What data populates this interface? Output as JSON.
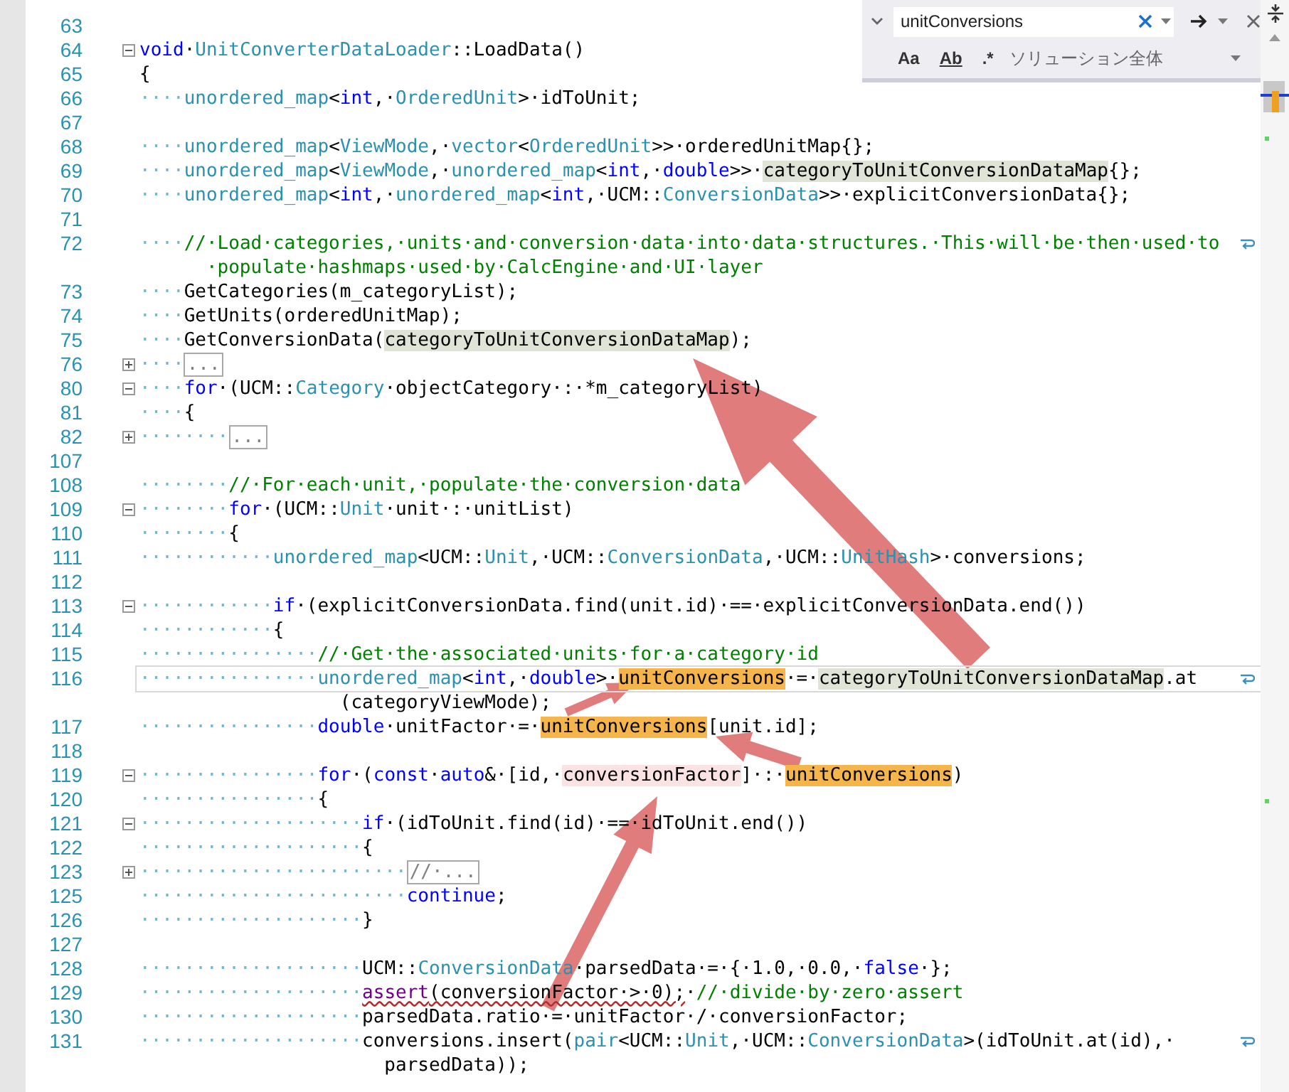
{
  "find_panel": {
    "search_value": "unitConversions",
    "options": [
      {
        "text": "Aa",
        "selected": false
      },
      {
        "text": "Ab",
        "selected": false
      },
      {
        "text": ".*",
        "selected": false
      }
    ],
    "scope": "ソリューション全体"
  },
  "lines": [
    {
      "number": "63"
    },
    {
      "number": "64",
      "fold": {
        "kind": "minus"
      },
      "segments": [
        {
          "kind": "keyword",
          "text": "void"
        },
        {
          "kind": "plain",
          "text": "·"
        },
        {
          "kind": "type",
          "text": "UnitConverterDataLoader"
        },
        {
          "kind": "plain",
          "text": "::LoadData()"
        }
      ]
    },
    {
      "number": "65",
      "segments": [
        {
          "kind": "plain",
          "text": "{"
        }
      ]
    },
    {
      "number": "66",
      "segments": [
        {
          "kind": "indent",
          "text": "····"
        },
        {
          "kind": "type",
          "text": "unordered_map"
        },
        {
          "kind": "plain",
          "text": "<"
        },
        {
          "kind": "keyword",
          "text": "int"
        },
        {
          "kind": "plain",
          "text": ",·"
        },
        {
          "kind": "type",
          "text": "OrderedUnit"
        },
        {
          "kind": "plain",
          "text": ">·idToUnit;"
        }
      ]
    },
    {
      "number": "67"
    },
    {
      "number": "68",
      "segments": [
        {
          "kind": "indent",
          "text": "····"
        },
        {
          "kind": "type",
          "text": "unordered_map"
        },
        {
          "kind": "plain",
          "text": "<"
        },
        {
          "kind": "type",
          "text": "ViewMode"
        },
        {
          "kind": "plain",
          "text": ",·"
        },
        {
          "kind": "type",
          "text": "vector"
        },
        {
          "kind": "plain",
          "text": "<"
        },
        {
          "kind": "type",
          "text": "OrderedUnit"
        },
        {
          "kind": "plain",
          "text": ">>·orderedUnitMap{};"
        }
      ]
    },
    {
      "number": "69",
      "segments": [
        {
          "kind": "indent",
          "text": "····"
        },
        {
          "kind": "type",
          "text": "unordered_map"
        },
        {
          "kind": "plain",
          "text": "<"
        },
        {
          "kind": "type",
          "text": "ViewMode"
        },
        {
          "kind": "plain",
          "text": ",·"
        },
        {
          "kind": "type",
          "text": "unordered_map"
        },
        {
          "kind": "plain",
          "text": "<"
        },
        {
          "kind": "keyword",
          "text": "int"
        },
        {
          "kind": "plain",
          "text": ",·"
        },
        {
          "kind": "keyword",
          "text": "double"
        },
        {
          "kind": "plain",
          "text": ">>·"
        },
        {
          "kind": "plain",
          "text": "categoryToUnitConversionDataMap",
          "highlight": {
            "kind": "reference"
          }
        },
        {
          "kind": "plain",
          "text": "{};"
        }
      ]
    },
    {
      "number": "70",
      "segments": [
        {
          "kind": "indent",
          "text": "····"
        },
        {
          "kind": "type",
          "text": "unordered_map"
        },
        {
          "kind": "plain",
          "text": "<"
        },
        {
          "kind": "keyword",
          "text": "int"
        },
        {
          "kind": "plain",
          "text": ",·"
        },
        {
          "kind": "type",
          "text": "unordered_map"
        },
        {
          "kind": "plain",
          "text": "<"
        },
        {
          "kind": "keyword",
          "text": "int"
        },
        {
          "kind": "plain",
          "text": ",·UCM::"
        },
        {
          "kind": "type",
          "text": "ConversionData"
        },
        {
          "kind": "plain",
          "text": ">>·explicitConversionData{};"
        }
      ]
    },
    {
      "number": "71"
    },
    {
      "number": "72",
      "wrapped": true,
      "segments": [
        {
          "kind": "indent",
          "text": "····"
        },
        {
          "kind": "comment",
          "text": "//·Load·categories,·units·and·conversion·data·into·data·structures.·This·will·be·then·used·to"
        }
      ],
      "continuation": [
        {
          "kind": "comment",
          "text": "·populate·hashmaps·used·by·CalcEngine·and·UI·layer"
        }
      ]
    },
    {
      "number": "73",
      "segments": [
        {
          "kind": "indent",
          "text": "····"
        },
        {
          "kind": "plain",
          "text": "GetCategories(m_categoryList);"
        }
      ]
    },
    {
      "number": "74",
      "segments": [
        {
          "kind": "indent",
          "text": "····"
        },
        {
          "kind": "plain",
          "text": "GetUnits(orderedUnitMap);"
        }
      ]
    },
    {
      "number": "75",
      "segments": [
        {
          "kind": "indent",
          "text": "····"
        },
        {
          "kind": "plain",
          "text": "GetConversionData("
        },
        {
          "kind": "plain",
          "text": "categoryToUnitConversionDataMap",
          "highlight": {
            "kind": "reference"
          }
        },
        {
          "kind": "plain",
          "text": ");"
        }
      ]
    },
    {
      "number": "76",
      "fold": {
        "kind": "plus"
      },
      "segments": [
        {
          "kind": "indent",
          "text": "····"
        },
        {
          "kind": "collapsed",
          "text": "..."
        }
      ]
    },
    {
      "number": "80",
      "fold": {
        "kind": "minus"
      },
      "segments": [
        {
          "kind": "indent",
          "text": "····"
        },
        {
          "kind": "keyword",
          "text": "for"
        },
        {
          "kind": "plain",
          "text": "·(UCM::"
        },
        {
          "kind": "type",
          "text": "Category"
        },
        {
          "kind": "plain",
          "text": "·objectCategory·:·*m_categoryList)"
        }
      ]
    },
    {
      "number": "81",
      "segments": [
        {
          "kind": "indent",
          "text": "····"
        },
        {
          "kind": "plain",
          "text": "{"
        }
      ]
    },
    {
      "number": "82",
      "fold": {
        "kind": "plus"
      },
      "segments": [
        {
          "kind": "indent",
          "text": "········"
        },
        {
          "kind": "collapsed",
          "text": "..."
        }
      ]
    },
    {
      "number": "107"
    },
    {
      "number": "108",
      "segments": [
        {
          "kind": "indent",
          "text": "········"
        },
        {
          "kind": "comment",
          "text": "//·For·each·unit,·populate·the·conversion·data"
        }
      ]
    },
    {
      "number": "109",
      "fold": {
        "kind": "minus"
      },
      "segments": [
        {
          "kind": "indent",
          "text": "········"
        },
        {
          "kind": "keyword",
          "text": "for"
        },
        {
          "kind": "plain",
          "text": "·(UCM::"
        },
        {
          "kind": "type",
          "text": "Unit"
        },
        {
          "kind": "plain",
          "text": "·unit·:·unitList)"
        }
      ]
    },
    {
      "number": "110",
      "segments": [
        {
          "kind": "indent",
          "text": "········"
        },
        {
          "kind": "plain",
          "text": "{"
        }
      ]
    },
    {
      "number": "111",
      "segments": [
        {
          "kind": "indent",
          "text": "············"
        },
        {
          "kind": "type",
          "text": "unordered_map"
        },
        {
          "kind": "plain",
          "text": "<UCM::"
        },
        {
          "kind": "type",
          "text": "Unit"
        },
        {
          "kind": "plain",
          "text": ",·UCM::"
        },
        {
          "kind": "type",
          "text": "ConversionData"
        },
        {
          "kind": "plain",
          "text": ",·UCM::"
        },
        {
          "kind": "type",
          "text": "UnitHash"
        },
        {
          "kind": "plain",
          "text": ">·conversions;"
        }
      ]
    },
    {
      "number": "112"
    },
    {
      "number": "113",
      "fold": {
        "kind": "minus"
      },
      "segments": [
        {
          "kind": "indent",
          "text": "············"
        },
        {
          "kind": "keyword",
          "text": "if"
        },
        {
          "kind": "plain",
          "text": "·(explicitConversionData.find(unit.id)·==·explicitConversionData.end())"
        }
      ]
    },
    {
      "number": "114",
      "segments": [
        {
          "kind": "indent",
          "text": "············"
        },
        {
          "kind": "plain",
          "text": "{"
        }
      ]
    },
    {
      "number": "115",
      "segments": [
        {
          "kind": "indent",
          "text": "················"
        },
        {
          "kind": "comment",
          "text": "//·Get·the·associated·units·for·a·category·id"
        }
      ]
    },
    {
      "number": "116",
      "current": true,
      "wrapped": true,
      "segments": [
        {
          "kind": "indent",
          "text": "················"
        },
        {
          "kind": "type",
          "text": "unordered_map"
        },
        {
          "kind": "plain",
          "text": "<"
        },
        {
          "kind": "keyword",
          "text": "int"
        },
        {
          "kind": "plain",
          "text": ",·"
        },
        {
          "kind": "keyword",
          "text": "double"
        },
        {
          "kind": "plain",
          "text": ">·"
        },
        {
          "kind": "plain",
          "text": "unitConversions",
          "highlight": {
            "kind": "find"
          }
        },
        {
          "kind": "plain",
          "text": "·=·"
        },
        {
          "kind": "plain",
          "text": "categoryToUnitConversionDataMap",
          "highlight": {
            "kind": "reference"
          }
        },
        {
          "kind": "plain",
          "text": ".at"
        }
      ],
      "continuation": [
        {
          "kind": "plain",
          "text": "(categoryViewMode);"
        }
      ]
    },
    {
      "number": "117",
      "segments": [
        {
          "kind": "indent",
          "text": "················"
        },
        {
          "kind": "keyword",
          "text": "double"
        },
        {
          "kind": "plain",
          "text": "·unitFactor·=·"
        },
        {
          "kind": "plain",
          "text": "unitConversions",
          "highlight": {
            "kind": "find"
          }
        },
        {
          "kind": "plain",
          "text": "[unit.id];"
        }
      ]
    },
    {
      "number": "118"
    },
    {
      "number": "119",
      "fold": {
        "kind": "minus"
      },
      "segments": [
        {
          "kind": "indent",
          "text": "················"
        },
        {
          "kind": "keyword",
          "text": "for"
        },
        {
          "kind": "plain",
          "text": "·("
        },
        {
          "kind": "keyword",
          "text": "const"
        },
        {
          "kind": "plain",
          "text": "·"
        },
        {
          "kind": "keyword",
          "text": "auto"
        },
        {
          "kind": "plain",
          "text": "&·[id,·"
        },
        {
          "kind": "plain",
          "text": "conversionFactor",
          "highlight": {
            "kind": "write"
          }
        },
        {
          "kind": "plain",
          "text": "]·:·"
        },
        {
          "kind": "plain",
          "text": "unitConversions",
          "highlight": {
            "kind": "find"
          }
        },
        {
          "kind": "plain",
          "text": ")"
        }
      ]
    },
    {
      "number": "120",
      "segments": [
        {
          "kind": "indent",
          "text": "················"
        },
        {
          "kind": "plain",
          "text": "{"
        }
      ]
    },
    {
      "number": "121",
      "fold": {
        "kind": "minus"
      },
      "segments": [
        {
          "kind": "indent",
          "text": "····················"
        },
        {
          "kind": "keyword",
          "text": "if"
        },
        {
          "kind": "plain",
          "text": "·(idToUnit.find(id)·==·idToUnit.end())"
        }
      ]
    },
    {
      "number": "122",
      "segments": [
        {
          "kind": "indent",
          "text": "····················"
        },
        {
          "kind": "plain",
          "text": "{"
        }
      ]
    },
    {
      "number": "123",
      "fold": {
        "kind": "plus"
      },
      "segments": [
        {
          "kind": "indent",
          "text": "························"
        },
        {
          "kind": "collapsed",
          "text": "//·..."
        }
      ]
    },
    {
      "number": "125",
      "segments": [
        {
          "kind": "indent",
          "text": "························"
        },
        {
          "kind": "keyword",
          "text": "continue"
        },
        {
          "kind": "plain",
          "text": ";"
        }
      ]
    },
    {
      "number": "126",
      "segments": [
        {
          "kind": "indent",
          "text": "····················"
        },
        {
          "kind": "plain",
          "text": "}"
        }
      ]
    },
    {
      "number": "127"
    },
    {
      "number": "128",
      "segments": [
        {
          "kind": "indent",
          "text": "····················"
        },
        {
          "kind": "plain",
          "text": "UCM::"
        },
        {
          "kind": "type",
          "text": "ConversionData"
        },
        {
          "kind": "plain",
          "text": "·parsedData·=·{·1.0,·0.0,·"
        },
        {
          "kind": "keyword",
          "text": "false"
        },
        {
          "kind": "plain",
          "text": "·};"
        }
      ]
    },
    {
      "number": "129",
      "segments": [
        {
          "kind": "indent",
          "text": "····················"
        },
        {
          "kind": "macro",
          "text": "assert",
          "highlight": {
            "kind": "squiggle"
          }
        },
        {
          "kind": "plain",
          "text": "(conversionFactor·>·0);",
          "highlight": {
            "kind": "squiggle"
          }
        },
        {
          "kind": "plain",
          "text": "·"
        },
        {
          "kind": "comment",
          "text": "//·divide·by·zero·assert"
        }
      ]
    },
    {
      "number": "130",
      "segments": [
        {
          "kind": "indent",
          "text": "····················"
        },
        {
          "kind": "plain",
          "text": "parsedData.ratio·=·unitFactor·/·conversionFactor;"
        }
      ]
    },
    {
      "number": "131",
      "wrapped": true,
      "segments": [
        {
          "kind": "indent",
          "text": "····················"
        },
        {
          "kind": "plain",
          "text": "conversions.insert("
        },
        {
          "kind": "type",
          "text": "pair"
        },
        {
          "kind": "plain",
          "text": "<UCM::"
        },
        {
          "kind": "type",
          "text": "Unit"
        },
        {
          "kind": "plain",
          "text": ",·UCM::"
        },
        {
          "kind": "type",
          "text": "ConversionData"
        },
        {
          "kind": "plain",
          "text": ">(idToUnit.at(id),·"
        }
      ],
      "continuation": [
        {
          "kind": "plain",
          "text": "parsedData));"
        }
      ]
    }
  ]
}
